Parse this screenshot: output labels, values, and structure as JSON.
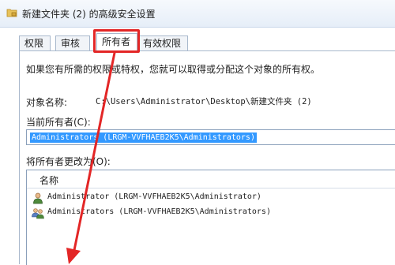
{
  "window": {
    "title": "新建文件夹 (2) 的高级安全设置",
    "icon": "folder-lock-icon"
  },
  "tabs": [
    {
      "label": "权限"
    },
    {
      "label": "审核"
    },
    {
      "label": "所有者",
      "active": true
    },
    {
      "label": "有效权限"
    }
  ],
  "owner_tab": {
    "description": "如果您有所需的权限或特权，您就可以取得或分配这个对象的所有权。",
    "object_name_label": "对象名称:",
    "object_name_value": "C:\\Users\\Administrator\\Desktop\\新建文件夹 (2)",
    "current_owner_label": "当前所有者(C):",
    "current_owner_value": "Administrators (LRGM-VVFHAEB2K5\\Administrators)",
    "change_owner_label": "将所有者更改为(O):",
    "list_header": "名称",
    "owners": [
      {
        "icon": "user-icon",
        "label": "Administrator (LRGM-VVFHAEB2K5\\Administrator)"
      },
      {
        "icon": "group-icon",
        "label": "Administrators (LRGM-VVFHAEB2K5\\Administrators)"
      }
    ]
  },
  "colors": {
    "highlight": "#e32626",
    "selection": "#3399ff"
  }
}
